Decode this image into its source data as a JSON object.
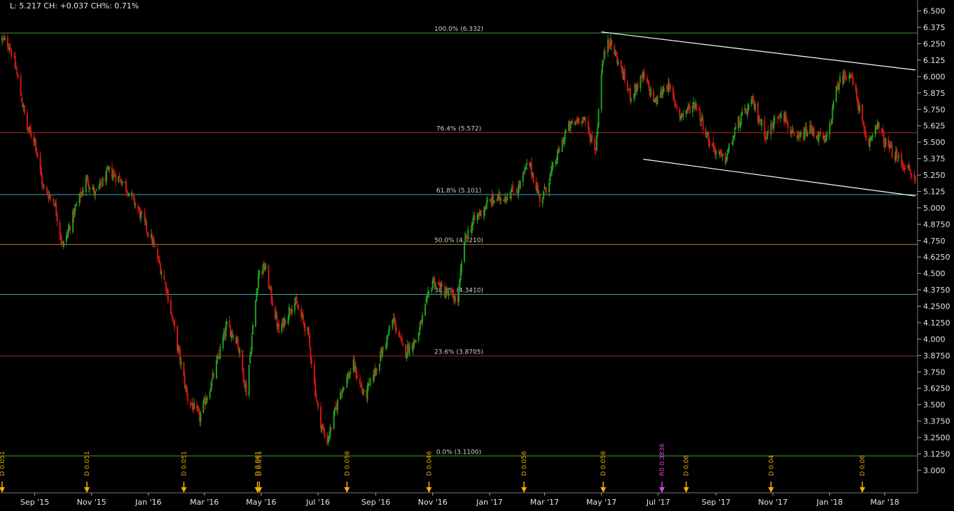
{
  "header": {
    "quote": "L: 5.217 CH: +0.037 CH%: 0.71%"
  },
  "chart_data": {
    "type": "candlestick",
    "y_axis": {
      "range": [
        2.93,
        6.53
      ],
      "ticks": [
        "6.500",
        "6.375",
        "6.250",
        "6.125",
        "6.000",
        "5.875",
        "5.750",
        "5.625",
        "5.500",
        "5.375",
        "5.250",
        "5.125",
        "5.000",
        "4.8750",
        "4.750",
        "4.6250",
        "4.500",
        "4.3750",
        "4.2500",
        "4.1250",
        "4.000",
        "3.8750",
        "3.750",
        "3.6250",
        "3.500",
        "3.3750",
        "3.2500",
        "3.1250",
        "3.000"
      ],
      "tick_values": [
        6.5,
        6.375,
        6.25,
        6.125,
        6.0,
        5.875,
        5.75,
        5.625,
        5.5,
        5.375,
        5.25,
        5.125,
        5.0,
        4.875,
        4.75,
        4.625,
        4.5,
        4.375,
        4.25,
        4.125,
        4.0,
        3.875,
        3.75,
        3.625,
        3.5,
        3.375,
        3.25,
        3.125,
        3.0
      ]
    },
    "x_axis": {
      "range": [
        "2015-07-28",
        "2018-04-03"
      ],
      "ticks": [
        {
          "label": "Sep '15",
          "date": "2015-09-01"
        },
        {
          "label": "Nov '15",
          "date": "2015-11-01"
        },
        {
          "label": "Jan '16",
          "date": "2016-01-01"
        },
        {
          "label": "Mar '16",
          "date": "2016-03-01"
        },
        {
          "label": "May '16",
          "date": "2016-05-01"
        },
        {
          "label": "Jul '16",
          "date": "2016-07-01"
        },
        {
          "label": "Sep '16",
          "date": "2016-09-01"
        },
        {
          "label": "Nov '16",
          "date": "2016-11-01"
        },
        {
          "label": "Jan '17",
          "date": "2017-01-01"
        },
        {
          "label": "Mar '17",
          "date": "2017-03-01"
        },
        {
          "label": "May '17",
          "date": "2017-05-01"
        },
        {
          "label": "Jul '17",
          "date": "2017-07-01"
        },
        {
          "label": "Sep '17",
          "date": "2017-09-01"
        },
        {
          "label": "Nov '17",
          "date": "2017-11-01"
        },
        {
          "label": "Jan '18",
          "date": "2018-01-01"
        },
        {
          "label": "Mar '18",
          "date": "2018-03-01"
        }
      ]
    },
    "fib_levels": [
      {
        "label": "100.0% (6.332)",
        "value": 6.332,
        "color": "#3a9a3a"
      },
      {
        "label": "76.4% (5.572)",
        "value": 5.572,
        "color": "#b02020"
      },
      {
        "label": "61.8% (5.101)",
        "value": 5.101,
        "color": "#3fa9b8"
      },
      {
        "label": "50.0% (4.7210)",
        "value": 4.721,
        "color": "#b58a20"
      },
      {
        "label": "38.2% (4.3410)",
        "value": 4.341,
        "color": "#3fa9b8"
      },
      {
        "label": "23.6% (3.8705)",
        "value": 3.8705,
        "color": "#b02020"
      },
      {
        "label": "0.0% (3.1100)",
        "value": 3.11,
        "color": "#3a9a3a"
      }
    ],
    "trendlines": [
      {
        "from": {
          "date": "2017-05-01",
          "value": 6.34
        },
        "to": {
          "date": "2018-04-03",
          "value": 6.05
        },
        "color": "#ffffff"
      },
      {
        "from": {
          "date": "2017-06-15",
          "value": 5.37
        },
        "to": {
          "date": "2018-04-03",
          "value": 5.09
        },
        "color": "#ffffff"
      }
    ],
    "price_path": [
      {
        "date": "2015-07-28",
        "value": 6.28
      },
      {
        "date": "2015-08-05",
        "value": 6.24
      },
      {
        "date": "2015-08-12",
        "value": 6.05
      },
      {
        "date": "2015-08-24",
        "value": 5.6
      },
      {
        "date": "2015-09-01",
        "value": 5.52
      },
      {
        "date": "2015-09-10",
        "value": 5.15
      },
      {
        "date": "2015-09-22",
        "value": 5.05
      },
      {
        "date": "2015-10-01",
        "value": 4.7
      },
      {
        "date": "2015-10-15",
        "value": 5.0
      },
      {
        "date": "2015-10-27",
        "value": 5.22
      },
      {
        "date": "2015-11-05",
        "value": 5.1
      },
      {
        "date": "2015-11-20",
        "value": 5.28
      },
      {
        "date": "2015-12-05",
        "value": 5.2
      },
      {
        "date": "2015-12-20",
        "value": 5.0
      },
      {
        "date": "2016-01-05",
        "value": 4.75
      },
      {
        "date": "2016-01-20",
        "value": 4.4
      },
      {
        "date": "2016-02-01",
        "value": 3.95
      },
      {
        "date": "2016-02-12",
        "value": 3.55
      },
      {
        "date": "2016-02-25",
        "value": 3.4
      },
      {
        "date": "2016-03-10",
        "value": 3.7
      },
      {
        "date": "2016-03-25",
        "value": 4.1
      },
      {
        "date": "2016-04-05",
        "value": 4.0
      },
      {
        "date": "2016-04-15",
        "value": 3.6
      },
      {
        "date": "2016-04-28",
        "value": 4.5
      },
      {
        "date": "2016-05-05",
        "value": 4.55
      },
      {
        "date": "2016-05-20",
        "value": 4.05
      },
      {
        "date": "2016-06-05",
        "value": 4.3
      },
      {
        "date": "2016-06-20",
        "value": 4.05
      },
      {
        "date": "2016-07-01",
        "value": 3.45
      },
      {
        "date": "2016-07-10",
        "value": 3.2
      },
      {
        "date": "2016-07-25",
        "value": 3.6
      },
      {
        "date": "2016-08-08",
        "value": 3.8
      },
      {
        "date": "2016-08-20",
        "value": 3.55
      },
      {
        "date": "2016-09-05",
        "value": 3.85
      },
      {
        "date": "2016-09-20",
        "value": 4.15
      },
      {
        "date": "2016-10-01",
        "value": 3.9
      },
      {
        "date": "2016-10-15",
        "value": 4.0
      },
      {
        "date": "2016-11-01",
        "value": 4.45
      },
      {
        "date": "2016-11-15",
        "value": 4.35
      },
      {
        "date": "2016-11-28",
        "value": 4.3
      },
      {
        "date": "2016-12-05",
        "value": 4.75
      },
      {
        "date": "2016-12-15",
        "value": 4.9
      },
      {
        "date": "2017-01-01",
        "value": 5.05
      },
      {
        "date": "2017-01-15",
        "value": 5.08
      },
      {
        "date": "2017-02-01",
        "value": 5.15
      },
      {
        "date": "2017-02-12",
        "value": 5.35
      },
      {
        "date": "2017-02-25",
        "value": 5.05
      },
      {
        "date": "2017-03-10",
        "value": 5.3
      },
      {
        "date": "2017-03-25",
        "value": 5.6
      },
      {
        "date": "2017-04-10",
        "value": 5.7
      },
      {
        "date": "2017-04-25",
        "value": 5.45
      },
      {
        "date": "2017-05-01",
        "value": 6.05
      },
      {
        "date": "2017-05-08",
        "value": 6.3
      },
      {
        "date": "2017-05-20",
        "value": 6.1
      },
      {
        "date": "2017-06-01",
        "value": 5.85
      },
      {
        "date": "2017-06-15",
        "value": 6.0
      },
      {
        "date": "2017-06-28",
        "value": 5.8
      },
      {
        "date": "2017-07-10",
        "value": 5.95
      },
      {
        "date": "2017-07-25",
        "value": 5.7
      },
      {
        "date": "2017-08-10",
        "value": 5.8
      },
      {
        "date": "2017-08-25",
        "value": 5.5
      },
      {
        "date": "2017-09-10",
        "value": 5.35
      },
      {
        "date": "2017-09-25",
        "value": 5.65
      },
      {
        "date": "2017-10-10",
        "value": 5.8
      },
      {
        "date": "2017-10-25",
        "value": 5.55
      },
      {
        "date": "2017-11-10",
        "value": 5.75
      },
      {
        "date": "2017-11-25",
        "value": 5.5
      },
      {
        "date": "2017-12-10",
        "value": 5.6
      },
      {
        "date": "2017-12-28",
        "value": 5.5
      },
      {
        "date": "2018-01-10",
        "value": 5.95
      },
      {
        "date": "2018-01-22",
        "value": 6.05
      },
      {
        "date": "2018-02-02",
        "value": 5.75
      },
      {
        "date": "2018-02-10",
        "value": 5.45
      },
      {
        "date": "2018-02-20",
        "value": 5.65
      },
      {
        "date": "2018-03-01",
        "value": 5.5
      },
      {
        "date": "2018-03-12",
        "value": 5.4
      },
      {
        "date": "2018-03-25",
        "value": 5.3
      },
      {
        "date": "2018-04-03",
        "value": 5.2
      }
    ],
    "dividends": [
      {
        "label": "D 0.051",
        "date": "2015-07-28",
        "color": "#f0b000"
      },
      {
        "label": "D 0.051",
        "date": "2015-10-27",
        "color": "#f0b000"
      },
      {
        "label": "D 0.051",
        "date": "2016-02-08",
        "color": "#f0b000"
      },
      {
        "label": "D 0.061",
        "date": "2016-04-27",
        "color": "#f0b000"
      },
      {
        "label": "D 0.051",
        "date": "2016-04-29",
        "color": "#f0b000"
      },
      {
        "label": "D 0.056",
        "date": "2016-08-01",
        "color": "#f0b000"
      },
      {
        "label": "D 0.046",
        "date": "2016-10-28",
        "color": "#f0b000"
      },
      {
        "label": "D 0.056",
        "date": "2017-02-07",
        "color": "#f0b000"
      },
      {
        "label": "D 0.056",
        "date": "2017-05-03",
        "color": "#f0b000"
      },
      {
        "label": "R0 0.3836",
        "date": "2017-07-05",
        "color": "#e040e0"
      },
      {
        "label": "D 0.06",
        "date": "2017-07-31",
        "color": "#f0b000"
      },
      {
        "label": "D 0.04",
        "date": "2017-10-30",
        "color": "#f0b000"
      },
      {
        "label": "D 0.06",
        "date": "2018-02-05",
        "color": "#f0b000"
      }
    ]
  }
}
